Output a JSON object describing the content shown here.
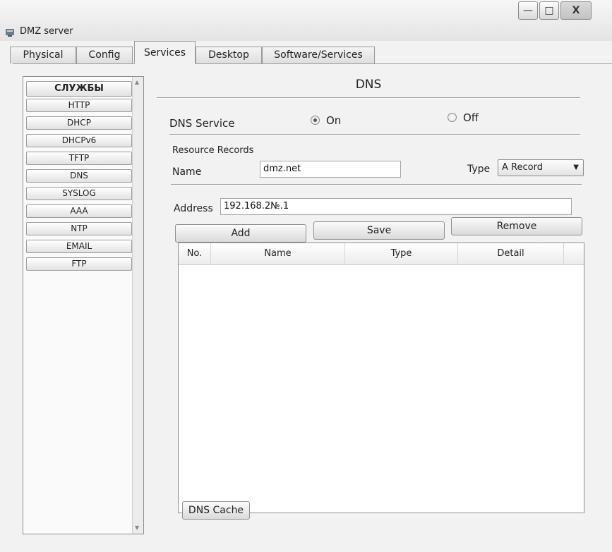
{
  "window": {
    "title": "DMZ server",
    "controls": {
      "minimize": "—",
      "maximize": "□",
      "close": "X"
    }
  },
  "tabs": [
    {
      "label": "Physical"
    },
    {
      "label": "Config"
    },
    {
      "label": "Services",
      "active": true
    },
    {
      "label": "Desktop"
    },
    {
      "label": "Software/Services"
    }
  ],
  "services": {
    "header": "СЛУЖБЫ",
    "items": [
      "HTTP",
      "DHCP",
      "DHCPv6",
      "TFTP",
      "DNS",
      "SYSLOG",
      "AAA",
      "NTP",
      "EMAIL",
      "FTP"
    ]
  },
  "dns": {
    "title": "DNS",
    "service_label": "DNS Service",
    "on_label": "On",
    "off_label": "Off",
    "service_state": "On",
    "resource_records_label": "Resource Records",
    "name_label": "Name",
    "name_value": "dmz.net",
    "type_label": "Type",
    "type_value": "A Record",
    "address_label": "Address",
    "address_value": "192.168.2№.1",
    "buttons": {
      "add": "Add",
      "save": "Save",
      "remove": "Remove"
    },
    "table": {
      "columns": [
        "No.",
        "Name",
        "Type",
        "Detail"
      ],
      "rows": []
    },
    "cache_button": "DNS Cache"
  },
  "colors": {
    "window_bg": "#f2f2f2",
    "border": "#8f8f8f"
  }
}
